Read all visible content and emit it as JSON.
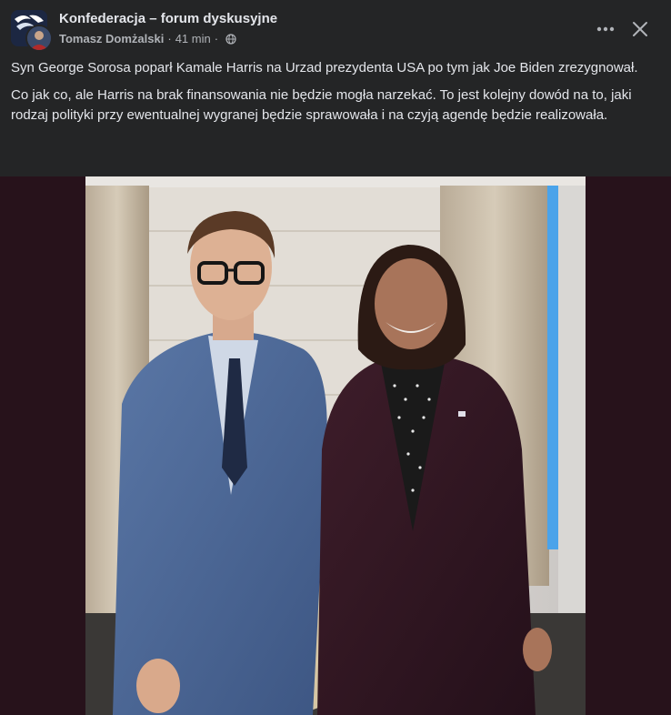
{
  "header": {
    "group_name": "Konfederacja – forum dyskusyjne",
    "author": "Tomasz Domżalski",
    "separator": "·",
    "time": "41 min",
    "privacy_icon": "globe-icon",
    "more_icon": "more-horizontal-icon",
    "close_icon": "close-icon"
  },
  "post": {
    "paragraphs": [
      "Syn George Sorosa poparł Kamale Harris na Urzad prezydenta USA po tym jak Joe Biden zrezygnował.",
      "Co jak co, ale Harris na brak finansowania nie będzie mogła narzekać. To jest kolejny dowód na to, jaki rodzaj polityki przy ewentualnej wygranej będzie sprawowała i na czyją agendę będzie realizowała."
    ]
  },
  "colors": {
    "background": "#242526",
    "text_primary": "#e4e6eb",
    "text_secondary": "#b0b3b8",
    "photo_backdrop": "#27121b"
  }
}
